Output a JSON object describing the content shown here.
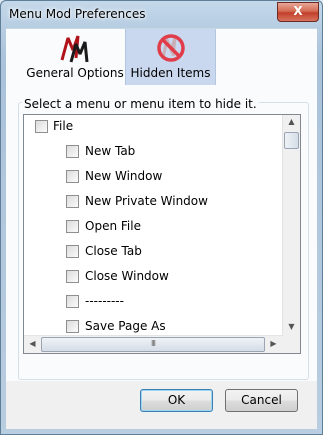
{
  "window": {
    "title": "Menu Mod Preferences",
    "close_label": "X"
  },
  "tabs": [
    {
      "label": "General Options",
      "icon": "menu-mod-logo-icon",
      "selected": false
    },
    {
      "label": "Hidden Items",
      "icon": "hidden-items-icon",
      "selected": true
    }
  ],
  "group": {
    "label": "Select a menu or menu item to hide it."
  },
  "tree": {
    "items": [
      {
        "label": "File",
        "level": 0,
        "checked": false
      },
      {
        "label": "New Tab",
        "level": 1,
        "checked": false
      },
      {
        "label": "New Window",
        "level": 1,
        "checked": false
      },
      {
        "label": "New Private Window",
        "level": 1,
        "checked": false
      },
      {
        "label": "Open File",
        "level": 1,
        "checked": false
      },
      {
        "label": "Close Tab",
        "level": 1,
        "checked": false
      },
      {
        "label": "Close Window",
        "level": 1,
        "checked": false
      },
      {
        "label": "---------",
        "level": 1,
        "checked": false
      },
      {
        "label": "Save Page As",
        "level": 1,
        "checked": false
      }
    ],
    "hscroll_grip": "III"
  },
  "buttons": {
    "ok": "OK",
    "cancel": "Cancel"
  },
  "colors": {
    "titlebar": "#b7cde2",
    "close": "#c0402b",
    "selected_tab": "#c9d8ee"
  }
}
